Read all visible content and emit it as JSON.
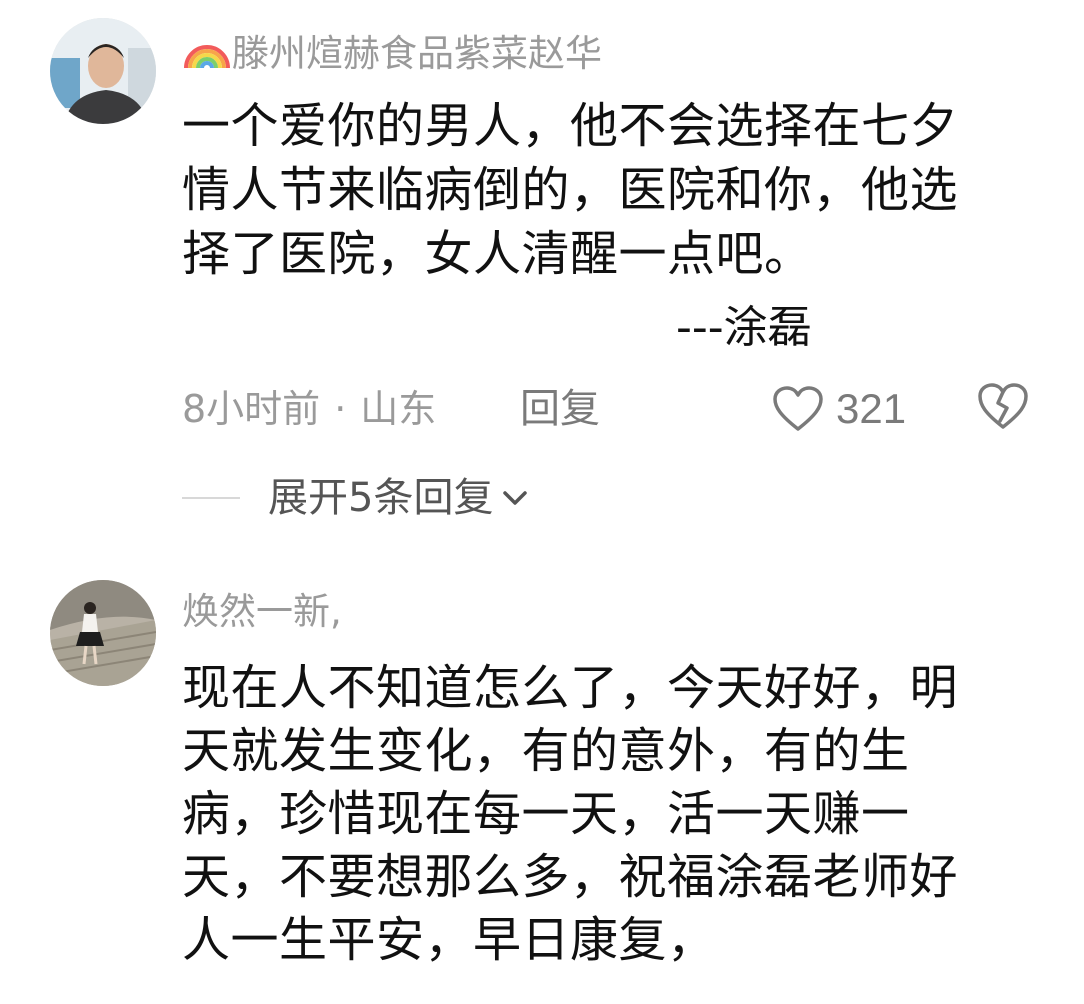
{
  "comments": [
    {
      "username_emoji": "rainbow-emoji",
      "username": "滕州煊赫食品紫菜赵华",
      "lines": [
        "一个爱你的男人，他不会选择在七夕",
        "情人节来临病倒的，医院和你，他选",
        "择了医院，女人清醒一点吧。"
      ],
      "signature": "---涂磊",
      "time": "8小时前",
      "location": "山东",
      "dot": "·",
      "reply_label": "回复",
      "like_count": "321",
      "expand_label": "展开5条回复"
    },
    {
      "username": "焕然一新,",
      "lines": [
        "现在人不知道怎么了，今天好好，明",
        "天就发生变化，有的意外，有的生",
        "病，珍惜现在每一天，活一天赚一",
        "天，不要想那么多，祝福涂磊老师好",
        "人一生平安，早日康复，"
      ]
    }
  ],
  "icons": {
    "like": "heart-outline-icon",
    "dislike": "broken-heart-icon",
    "expand": "chevron-down-icon"
  },
  "colors": {
    "text": "#111111",
    "muted": "#9a9a9a",
    "icon": "#7a7a7a"
  }
}
